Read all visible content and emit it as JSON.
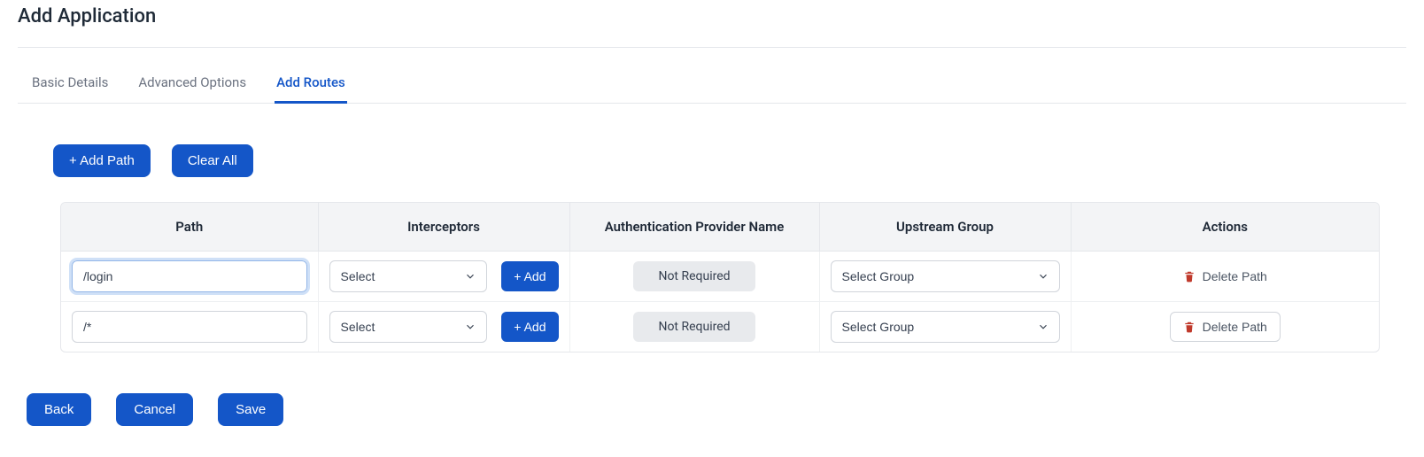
{
  "pageTitle": "Add Application",
  "tabs": [
    {
      "label": "Basic Details",
      "active": false
    },
    {
      "label": "Advanced Options",
      "active": false
    },
    {
      "label": "Add Routes",
      "active": true
    }
  ],
  "actions": {
    "addPath": "+ Add Path",
    "clearAll": "Clear All"
  },
  "table": {
    "headers": {
      "path": "Path",
      "interceptors": "Interceptors",
      "auth": "Authentication Provider Name",
      "upstream": "Upstream Group",
      "actions": "Actions"
    },
    "interceptorSelect": "Select",
    "addBtn": "+ Add",
    "authChip": "Not Required",
    "upstreamSelect": "Select Group",
    "deleteLabel": "Delete Path",
    "rows": [
      {
        "path": "/login",
        "focused": true,
        "deleteOutlined": false
      },
      {
        "path": "/*",
        "focused": false,
        "deleteOutlined": true
      }
    ]
  },
  "footer": {
    "back": "Back",
    "cancel": "Cancel",
    "save": "Save"
  },
  "colors": {
    "primary": "#1456c8",
    "trash": "#c0392b"
  }
}
